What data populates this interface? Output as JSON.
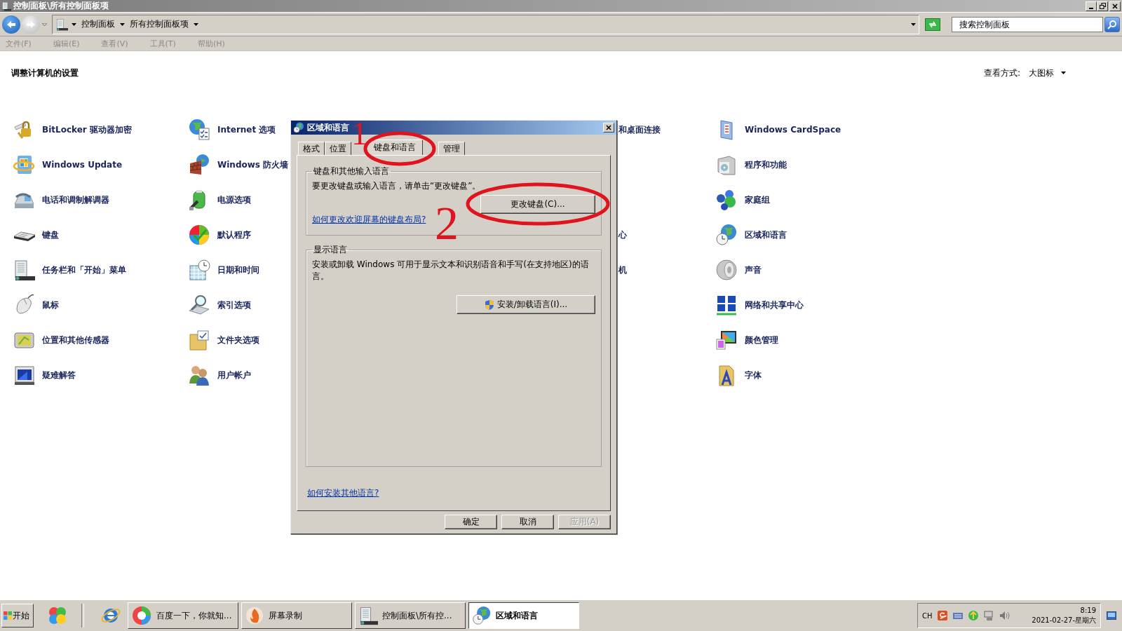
{
  "window": {
    "title": "控制面板\\所有控制面板项"
  },
  "address_bar": {
    "breadcrumbs": [
      "控制面板",
      "所有控制面板项"
    ],
    "search": {
      "placeholder": "搜索控制面板"
    }
  },
  "menu_bar": [
    "文件(F)",
    "编辑(E)",
    "查看(V)",
    "工具(T)",
    "帮助(H)"
  ],
  "content": {
    "heading": "调整计算机的设置",
    "view_by": {
      "label": "查看方式:",
      "value": "大图标"
    },
    "column_1": [
      "BitLocker 驱动器加密",
      "Windows Update",
      "电话和调制解调器",
      "键盘",
      "任务栏和「开始」菜单",
      "鼠标",
      "位置和其他传感器",
      "疑难解答"
    ],
    "column_2": [
      "Internet 选项",
      "Windows 防火墙",
      "电源选项",
      "默认程序",
      "日期和时间",
      "索引选项",
      "文件夹选项",
      "用户帐户"
    ],
    "column_3": [
      "和桌面连接",
      "心",
      "机"
    ],
    "column_4": [
      "Windows CardSpace",
      "程序和功能",
      "家庭组",
      "区域和语言",
      "声音",
      "网络和共享中心",
      "颜色管理",
      "字体"
    ]
  },
  "dialog": {
    "title": "区域和语言",
    "tabs": [
      {
        "label": "格式",
        "selected": false
      },
      {
        "label": "位置",
        "selected": false
      },
      {
        "label": "键盘和语言",
        "selected": true
      },
      {
        "label": "管理",
        "selected": false
      }
    ],
    "groups": [
      {
        "title": "键盘和其他输入语言",
        "text": "要更改键盘或输入语言，请单击“更改键盘”。",
        "button": {
          "label": "更改键盘(C)...",
          "kind": "plain"
        },
        "link": "如何更改欢迎屏幕的键盘布局?"
      },
      {
        "title": "显示语言",
        "text": "安装或卸载 Windows 可用于显示文本和识别语音和手写(在支持地区)的语言。",
        "button": {
          "label": "安装/卸载语言(I)...",
          "kind": "admin"
        }
      }
    ],
    "link": "如何安装其他语言?",
    "buttons": [
      {
        "label": "确定",
        "disabled": false
      },
      {
        "label": "取消",
        "disabled": false
      },
      {
        "label": "应用(A)",
        "disabled": true
      }
    ]
  },
  "annotations": [
    {
      "label": "1"
    },
    {
      "label": "2"
    }
  ],
  "taskbar": {
    "start": "开始",
    "tasks": [
      {
        "label": "百度一下，你就知...",
        "selected": false
      },
      {
        "label": "屏幕录制",
        "selected": false
      },
      {
        "label": "控制面板\\所有控...",
        "selected": false
      },
      {
        "label": "区域和语言",
        "selected": true
      }
    ],
    "tray": {
      "language": "CH",
      "time": "8:19",
      "date": "2021-02-27-星期六"
    }
  }
}
